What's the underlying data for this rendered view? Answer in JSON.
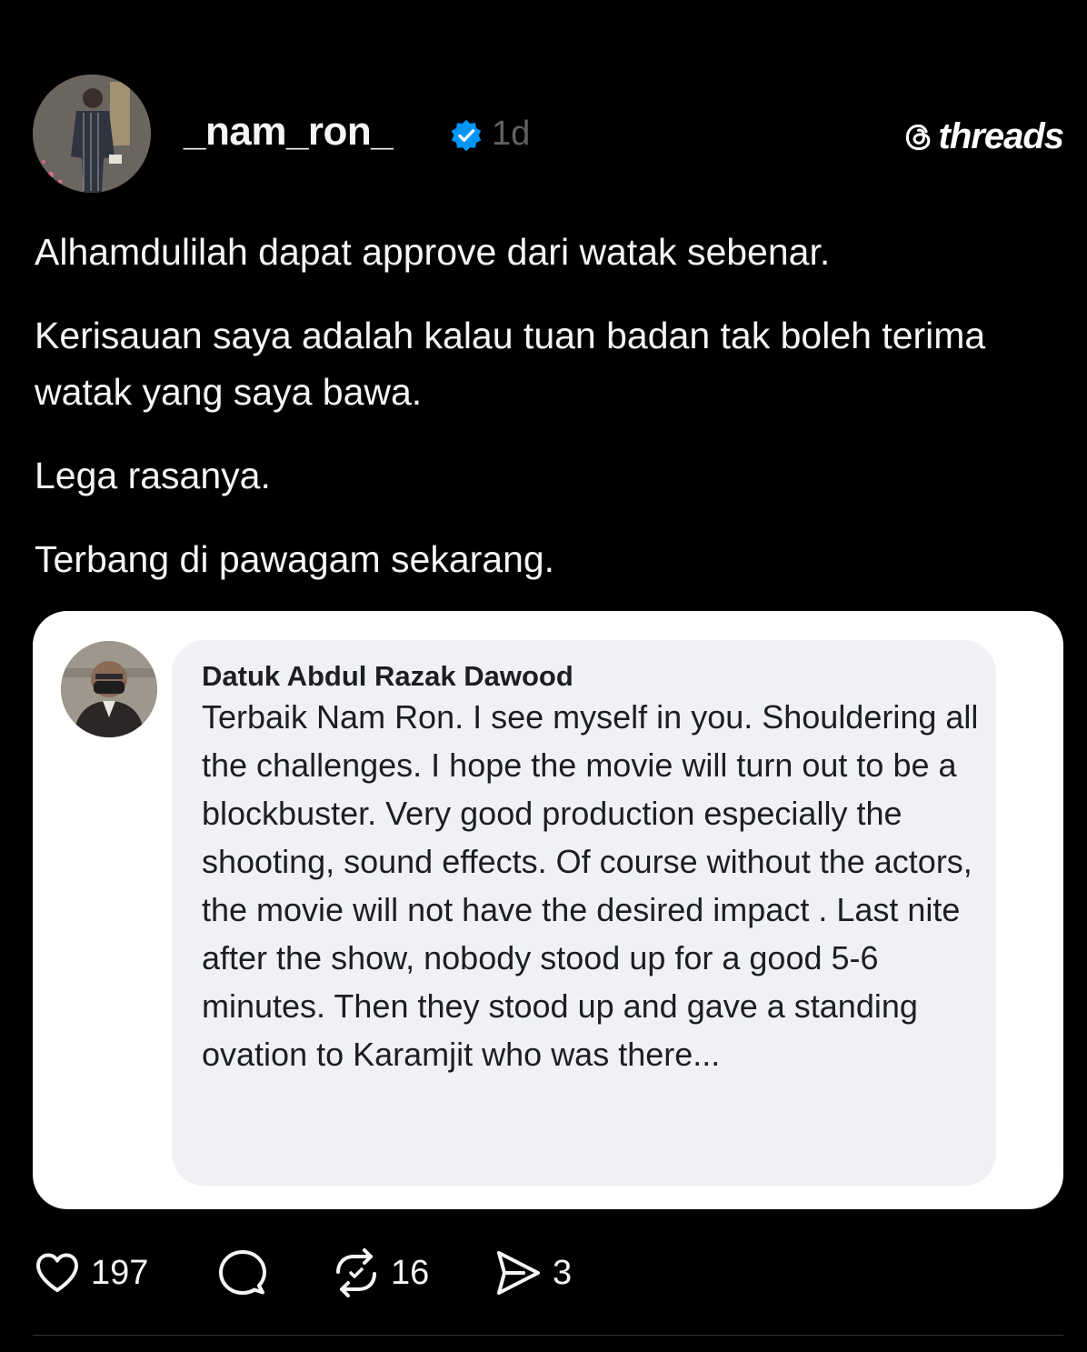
{
  "post": {
    "username": "_nam_ron_",
    "timestamp": "1d",
    "brand": "threads",
    "paragraphs": [
      "Alhamdulilah dapat approve dari watak sebenar.",
      "Kerisauan saya adalah kalau tuan badan tak boleh terima watak yang saya bawa.",
      "Lega rasanya.",
      "Terbang di pawagam sekarang."
    ]
  },
  "attachment": {
    "commenter_name": "Datuk Abdul Razak Dawood",
    "comment_text": "Terbaik Nam Ron. I see myself in you. Shouldering all the challenges. I hope the movie will turn out to be a blockbuster. Very good production especially the shooting, sound effects. Of course without the actors, the movie will not have the desired impact . Last nite after the show, nobody stood up for a good 5-6 minutes. Then they stood up and gave a standing ovation to Karamjit who was there..."
  },
  "actions": {
    "likes": "197",
    "comments": "",
    "reposts": "16",
    "shares": "3"
  },
  "icons": {
    "verified": "verified-badge-icon",
    "like": "heart-icon",
    "comment": "comment-bubble-icon",
    "repost": "repost-icon",
    "share": "send-icon",
    "brand": "threads-logo-icon"
  },
  "colors": {
    "background": "#000000",
    "text": "#f3f5f7",
    "muted": "#616161",
    "verified": "#0095f6",
    "card": "#ffffff",
    "bubble": "#eff1f5"
  }
}
